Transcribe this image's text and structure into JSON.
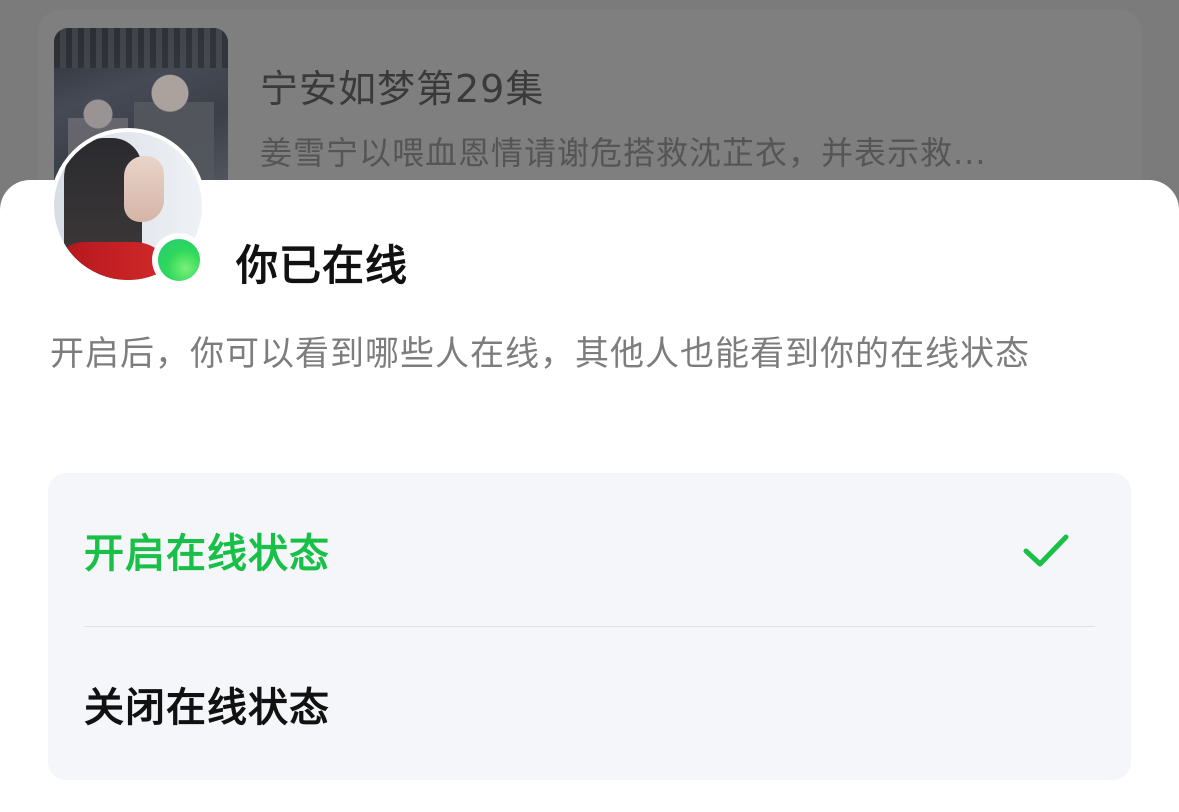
{
  "background_card": {
    "title": "宁安如梦第29集",
    "description": "姜雪宁以喂血恩情请谢危搭救沈芷衣，并表示救..."
  },
  "sheet": {
    "title": "你已在线",
    "description": "开启后，你可以看到哪些人在线，其他人也能看到你的在线状态",
    "options": [
      {
        "label": "开启在线状态",
        "selected": true
      },
      {
        "label": "关闭在线状态",
        "selected": false
      }
    ]
  },
  "colors": {
    "accent_green": "#19c048",
    "overlay_gray": "#7b7b7b",
    "options_bg": "#f5f6fa"
  },
  "icons": {
    "check": "check-icon",
    "online": "online-status-dot-icon"
  }
}
